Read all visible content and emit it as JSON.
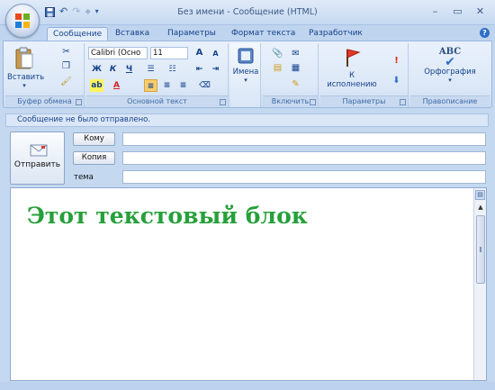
{
  "window": {
    "title": "Без имени - Сообщение (HTML)",
    "controls": {
      "minimize": "–",
      "maximize": "▭",
      "close": "✕"
    }
  },
  "quick_access": {
    "save_icon": "floppy-icon",
    "undo": "↶",
    "redo": "↷",
    "arrows": "◆",
    "menu": "▾"
  },
  "tabs": [
    "Сообщение",
    "Вставка",
    "Параметры",
    "Формат текста",
    "Разработчик"
  ],
  "help": "?",
  "ribbon": {
    "clipboard": {
      "paste_label": "Вставить",
      "group_label": "Буфер обмена"
    },
    "font": {
      "font_name": "Calibri (Осно",
      "font_size": "11",
      "grow": "A",
      "shrink": "A",
      "bold": "Ж",
      "italic": "К",
      "underline": "Ч",
      "font_color_letter": "A",
      "group_label": "Основной текст"
    },
    "names": {
      "label": "Имена"
    },
    "include": {
      "group_label": "Включить"
    },
    "options": {
      "followup_label": "К исполнению",
      "group_label": "Параметры"
    },
    "proofing": {
      "spelling_label": "Орфография",
      "abc": "ABC",
      "group_label": "Правописание"
    }
  },
  "infobar": {
    "text": "Сообщение не было отправлено."
  },
  "header": {
    "send_label": "Отправить",
    "to_label": "Кому",
    "cc_label": "Копия",
    "subject_label": "тема",
    "to_value": "",
    "cc_value": "",
    "subject_value": ""
  },
  "body": {
    "text": "Этот текстовый блок"
  },
  "colors": {
    "body_text": "#26a03a",
    "ribbon_bg": "#dce8f7",
    "accent": "#15428b"
  }
}
